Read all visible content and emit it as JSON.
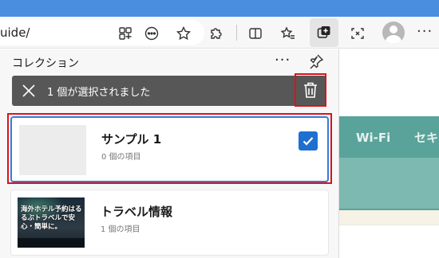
{
  "browser": {
    "url_fragment": "uide/",
    "toolbar_icons": [
      "apps-icon",
      "more-options-icon",
      "favorite-star-icon",
      "extensions-icon",
      "split-screen-icon",
      "favorites-list-icon",
      "collections-icon",
      "screenshot-icon",
      "profile-avatar-icon",
      "settings-more-icon"
    ],
    "menu_dots": "···"
  },
  "background_page": {
    "nav_items": [
      "Wi-Fi",
      "セキ"
    ]
  },
  "collections_panel": {
    "title": "コレクション",
    "more_dots": "···",
    "selection_bar": {
      "message": "1 個が選択されました",
      "close_icon": "close-icon",
      "delete_icon": "trash-icon"
    },
    "items": [
      {
        "title": "サンプル 1",
        "subtitle": "0 個の項目",
        "selected": true
      },
      {
        "title": "トラベル情報",
        "subtitle": "1 個の項目",
        "selected": false,
        "thumbnail_text": "海外ホテル予約はるるぶトラベルで安心・簡単に。"
      }
    ]
  },
  "colors": {
    "accent_blue": "#1f6fd1",
    "highlight_red": "#e0101a",
    "selection_bar": "#575757",
    "site_teal": "#5aa39a"
  }
}
